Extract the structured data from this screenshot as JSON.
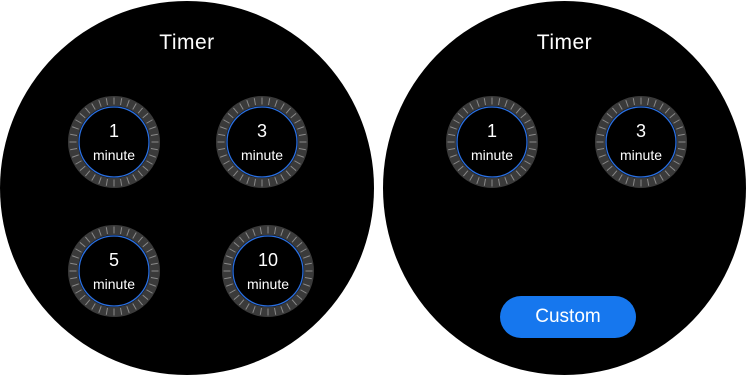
{
  "colors": {
    "screen_background": "#000000",
    "dial_ring": "#3a3a3a",
    "dial_tick": "#8a8a8a",
    "dial_accent": "#2a6fe0",
    "button_blue": "#1677ee",
    "text": "#ffffff"
  },
  "screens": [
    {
      "title": "Timer",
      "presets": [
        {
          "value": "1",
          "unit": "minute"
        },
        {
          "value": "3",
          "unit": "minute"
        },
        {
          "value": "5",
          "unit": "minute"
        },
        {
          "value": "10",
          "unit": "minute"
        }
      ]
    },
    {
      "title": "Timer",
      "presets": [
        {
          "value": "1",
          "unit": "minute"
        },
        {
          "value": "3",
          "unit": "minute"
        }
      ],
      "custom_label": "Custom"
    }
  ]
}
